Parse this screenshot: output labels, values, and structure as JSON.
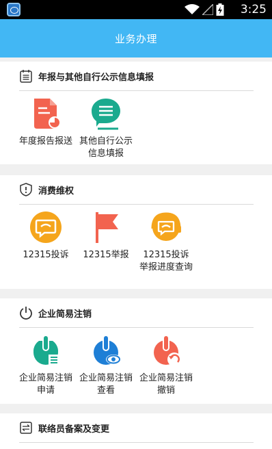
{
  "status_bar": {
    "time": "3:25"
  },
  "header": {
    "title": "业务办理"
  },
  "sections": [
    {
      "title": "年报与其他自行公示信息填报",
      "items": [
        {
          "label": "年度报告报送",
          "icon": "report-document-icon"
        },
        {
          "label": "其他自行公示信息填报",
          "icon": "chat-list-icon"
        }
      ]
    },
    {
      "title": "消费维权",
      "items": [
        {
          "label": "12315投诉",
          "icon": "complaint-bubble-icon"
        },
        {
          "label": "12315举报",
          "icon": "flag-icon"
        },
        {
          "label": "12315投诉举报进度查询",
          "icon": "headset-bubble-icon"
        }
      ]
    },
    {
      "title": "企业简易注销",
      "items": [
        {
          "label": "企业简易注销申请",
          "icon": "cancel-apply-icon"
        },
        {
          "label": "企业简易注销查看",
          "icon": "cancel-view-icon"
        },
        {
          "label": "企业简易注销撤销",
          "icon": "cancel-revoke-icon"
        }
      ]
    },
    {
      "title": "联络员备案及变更",
      "items": []
    }
  ],
  "colors": {
    "header": "#42b7f4",
    "red": "#f2634f",
    "teal": "#1aaa8e",
    "orange": "#f5a51c",
    "blue": "#1e7fd6"
  }
}
